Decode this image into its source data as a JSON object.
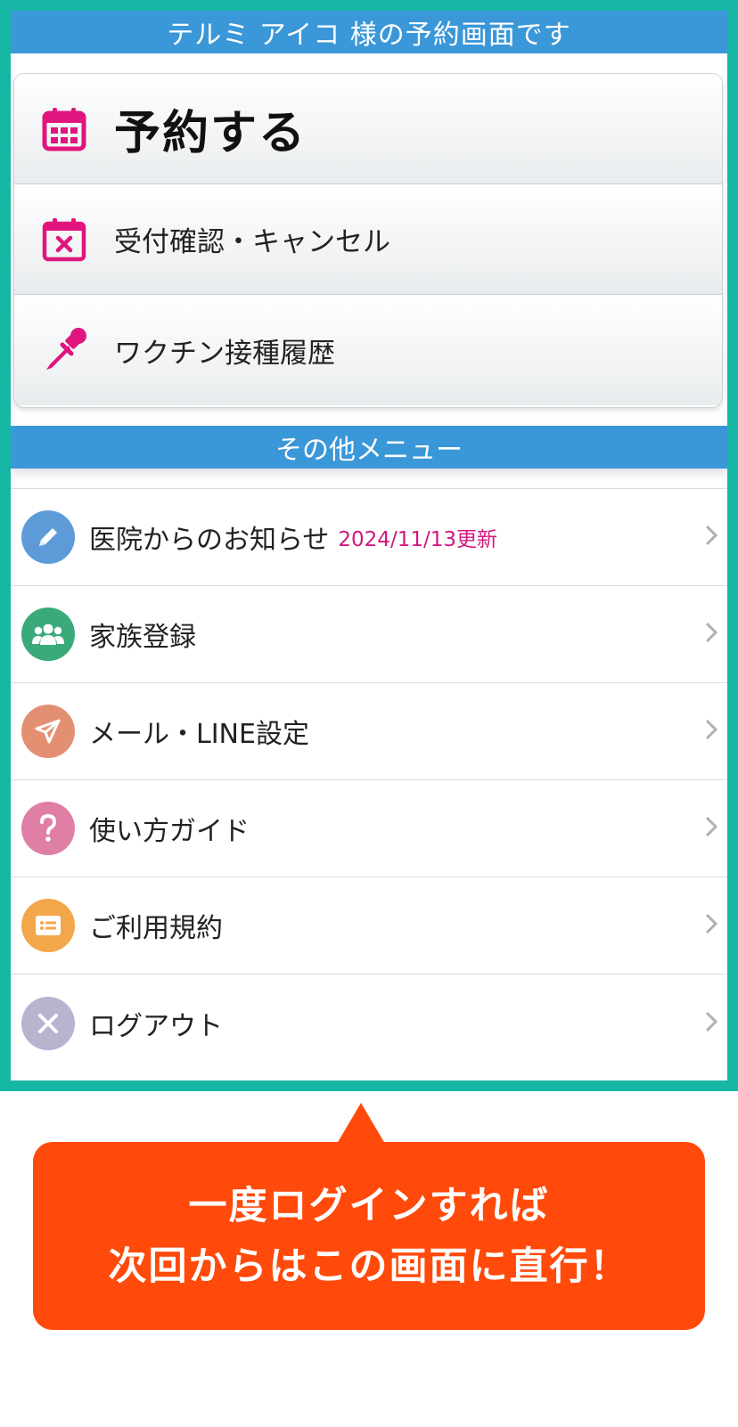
{
  "header": {
    "title": "テルミ アイコ 様の予約画面です"
  },
  "main_menu": [
    {
      "label": "予約する",
      "icon": "calendar-icon"
    },
    {
      "label": "受付確認・キャンセル",
      "icon": "calendar-cancel-icon"
    },
    {
      "label": "ワクチン接種履歴",
      "icon": "dropper-icon"
    }
  ],
  "other_menu": {
    "title": "その他メニュー",
    "items": [
      {
        "label": "医院からのお知らせ",
        "badge": "2024/11/13更新",
        "icon": "pencil-icon",
        "color": "#5d9bd8"
      },
      {
        "label": "家族登録",
        "icon": "family-icon",
        "color": "#3aaa7a"
      },
      {
        "label": "メール・LINE設定",
        "icon": "send-icon",
        "color": "#e39072"
      },
      {
        "label": "使い方ガイド",
        "icon": "question-icon",
        "color": "#e07fa6"
      },
      {
        "label": "ご利用規約",
        "icon": "document-icon",
        "color": "#f4a64a"
      },
      {
        "label": "ログアウト",
        "icon": "close-icon",
        "color": "#b6b4cf"
      }
    ]
  },
  "callout": {
    "line1": "一度ログインすれば",
    "line2": "次回からはこの画面に直行！"
  },
  "colors": {
    "frame": "#16b6a4",
    "header": "#3a97d8",
    "accent_pink": "#e0157e",
    "callout": "#ff4a0b"
  }
}
